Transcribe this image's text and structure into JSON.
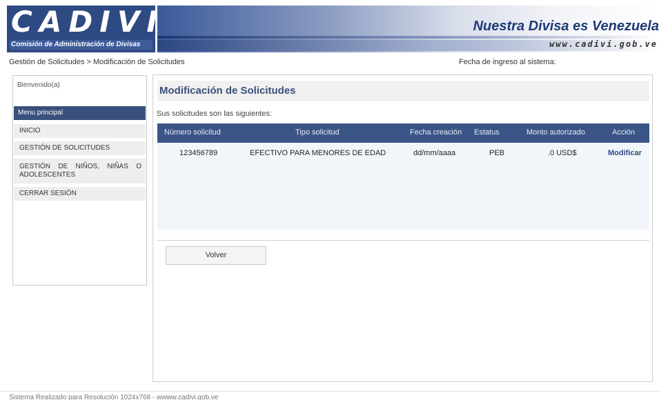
{
  "header": {
    "logo": "CADIVI",
    "logo_subtitle": "Comisión de Administración de Divisas",
    "slogan": "Nuestra Divisa es Venezuela",
    "url": "www.cadivi.gob.ve"
  },
  "breadcrumb": "Gestión de Solicitudes > Modificación de Solicitudes",
  "login_date_label": "Fecha de ingreso al sistema:",
  "sidebar": {
    "welcome": "Bienvenido(a)",
    "menu_header": "Menu principal",
    "items": [
      {
        "label": "INICIO"
      },
      {
        "label": "GESTIÓN DE SOLICITUDES"
      },
      {
        "label": "GESTIÓN DE NIÑOS, NIÑAS O ADOLESCENTES"
      },
      {
        "label": "CERRAR SESIÓN"
      }
    ]
  },
  "main": {
    "title": "Modificación de Solicitudes",
    "intro": "Sus solicitudes son las siguientes:",
    "table": {
      "columns": [
        "Número solicitud",
        "Tipo solicitud",
        "Fecha creación",
        "Estatus",
        "Monto autorizado",
        "Acción"
      ],
      "rows": [
        {
          "numero": "123456789",
          "tipo": "EFECTIVO PARA MENORES DE EDAD",
          "fecha": "dd/mm/aaaa",
          "estatus": "PEB",
          "monto": ".0 USD$",
          "accion": "Modificar"
        }
      ]
    },
    "back_button": "Volver"
  },
  "footer": "Sistema Realizado para Resolución 1024x768 - wwww.cadivi.gob.ve",
  "colors": {
    "brand": "#2e4a83",
    "table_header": "#3b5586",
    "menu_header": "#39507d"
  }
}
